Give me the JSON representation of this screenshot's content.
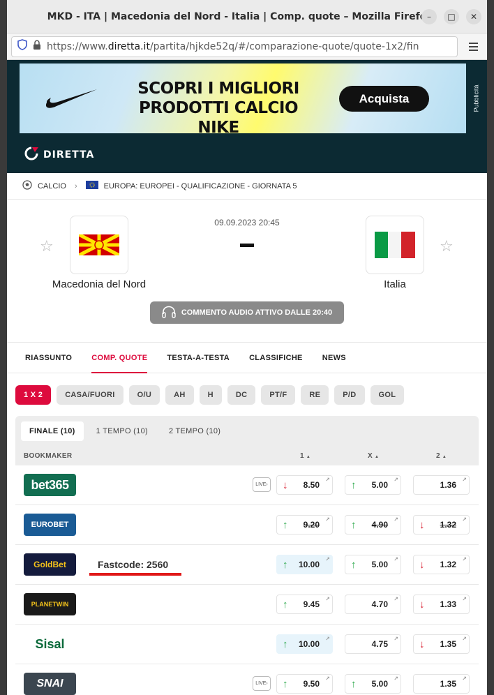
{
  "window": {
    "title": "MKD - ITA | Macedonia del Nord - Italia | Comp. quote – Mozilla Firefox",
    "controls": {
      "minimize": "–",
      "maximize": "□",
      "close": "✕"
    }
  },
  "browser": {
    "url_prefix": "https://www.",
    "url_domain": "diretta.it",
    "url_path": "/partita/hjkde52q/#/comparazione-quote/quote-1x2/fin"
  },
  "ad": {
    "tagline_line1": "SCOPRI I MIGLIORI",
    "tagline_line2": "PRODOTTI CALCIO NIKE",
    "cta": "Acquista",
    "side_label": "Pubblicità"
  },
  "brand": {
    "name": "DIRETTA"
  },
  "breadcrumb": {
    "sport": "CALCIO",
    "competition": "EUROPA: EUROPEI - QUALIFICAZIONE - GIORNATA 5"
  },
  "match": {
    "datetime": "09.09.2023 20:45",
    "home": {
      "name": "Macedonia del Nord"
    },
    "away": {
      "name": "Italia"
    },
    "audio_label": "COMMENTO AUDIO ATTIVO DALLE 20:40"
  },
  "tabs": [
    {
      "label": "RIASSUNTO"
    },
    {
      "label": "COMP. QUOTE"
    },
    {
      "label": "TESTA-A-TESTA"
    },
    {
      "label": "CLASSIFICHE"
    },
    {
      "label": "NEWS"
    }
  ],
  "markets": [
    "1 X 2",
    "CASA/FUORI",
    "O/U",
    "AH",
    "H",
    "DC",
    "PT/F",
    "RE",
    "P/D",
    "GOL"
  ],
  "periods": [
    "FINALE (10)",
    "1 TEMPO (10)",
    "2 TEMPO (10)"
  ],
  "table_header": {
    "bookmaker": "BOOKMAKER",
    "col1": "1",
    "colx": "X",
    "col2": "2",
    "sort_arrow": "▲"
  },
  "live_badge": "LIVE",
  "fastcode": "Fastcode: 2560",
  "bookmakers": [
    {
      "name": "bet365",
      "color": "#126e51",
      "live": true,
      "odds": [
        {
          "v": "8.50",
          "dir": "down"
        },
        {
          "v": "5.00",
          "dir": "up"
        },
        {
          "v": "1.36",
          "dir": ""
        }
      ]
    },
    {
      "name": "EUROBET",
      "color": "#1a5b95",
      "live": false,
      "odds": [
        {
          "v": "9.20",
          "dir": "up",
          "strike": true
        },
        {
          "v": "4.90",
          "dir": "up",
          "strike": true
        },
        {
          "v": "1.32",
          "dir": "down",
          "strike": true
        }
      ]
    },
    {
      "name": "GoldBet",
      "color": "#141b3d",
      "live": false,
      "odds": [
        {
          "v": "10.00",
          "dir": "up",
          "hl": true
        },
        {
          "v": "5.00",
          "dir": "up"
        },
        {
          "v": "1.32",
          "dir": "down"
        }
      ]
    },
    {
      "name": "PLANETWIN",
      "color": "#1a1a1a",
      "live": false,
      "odds": [
        {
          "v": "9.45",
          "dir": "up"
        },
        {
          "v": "4.70",
          "dir": ""
        },
        {
          "v": "1.33",
          "dir": "down"
        }
      ]
    },
    {
      "name": "Sisal",
      "color": "#ffffff",
      "live": false,
      "odds": [
        {
          "v": "10.00",
          "dir": "up",
          "hl": true
        },
        {
          "v": "4.75",
          "dir": ""
        },
        {
          "v": "1.35",
          "dir": "down"
        }
      ]
    },
    {
      "name": "SNAI",
      "color": "#3b4650",
      "live": true,
      "odds": [
        {
          "v": "9.50",
          "dir": "up"
        },
        {
          "v": "5.00",
          "dir": "up"
        },
        {
          "v": "1.35",
          "dir": ""
        }
      ]
    }
  ],
  "colors": {
    "accent": "#dd0b3d",
    "brand_bg": "#0c2a33",
    "up": "#2aa84a",
    "down": "#d8192b"
  }
}
